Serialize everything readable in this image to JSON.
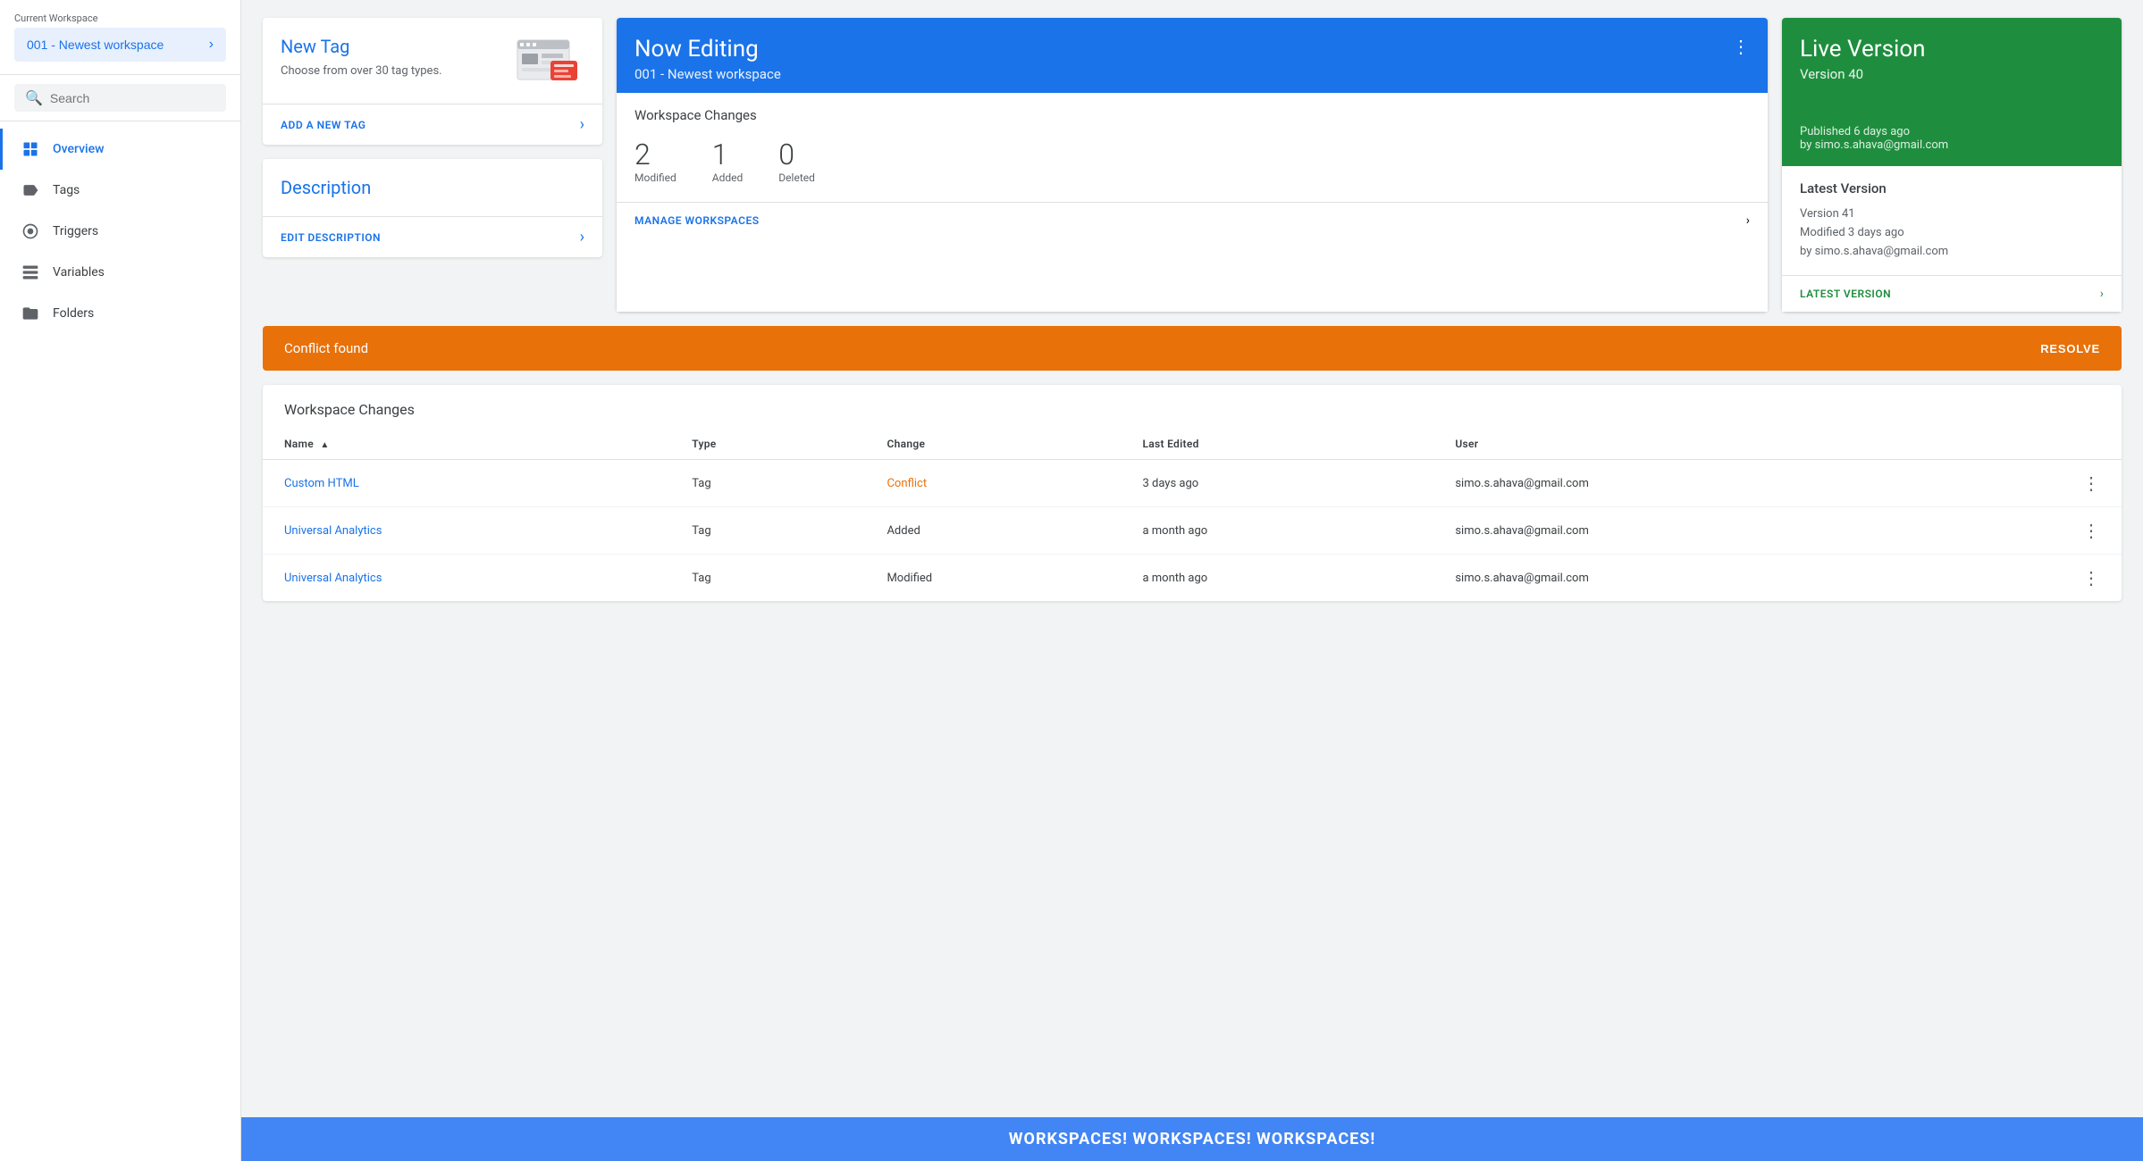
{
  "sidebar": {
    "current_label": "Current Workspace",
    "workspace_name": "001 - Newest workspace",
    "search_placeholder": "Search",
    "nav_items": [
      {
        "id": "overview",
        "label": "Overview",
        "icon": "folder-icon",
        "active": true
      },
      {
        "id": "tags",
        "label": "Tags",
        "icon": "tag-icon",
        "active": false
      },
      {
        "id": "triggers",
        "label": "Triggers",
        "icon": "trigger-icon",
        "active": false
      },
      {
        "id": "variables",
        "label": "Variables",
        "icon": "variable-icon",
        "active": false
      },
      {
        "id": "folders",
        "label": "Folders",
        "icon": "folders-icon",
        "active": false
      }
    ]
  },
  "new_tag_card": {
    "title": "New Tag",
    "description": "Choose from over 30 tag types.",
    "footer_link": "ADD A NEW TAG"
  },
  "description_card": {
    "title": "Description",
    "footer_link": "EDIT DESCRIPTION"
  },
  "now_editing_card": {
    "title": "Now Editing",
    "workspace_name": "001 - Newest workspace",
    "changes_title": "Workspace Changes",
    "stats": [
      {
        "number": "2",
        "label": "Modified"
      },
      {
        "number": "1",
        "label": "Added"
      },
      {
        "number": "0",
        "label": "Deleted"
      }
    ],
    "footer_link": "MANAGE WORKSPACES"
  },
  "live_version_card": {
    "title": "Live Version",
    "version": "Version 40",
    "published_text": "Published 6 days ago",
    "published_by": "by simo.s.ahava@gmail.com",
    "latest_section_title": "Latest Version",
    "version_detail": "Version 41",
    "modified_text": "Modified 3 days ago",
    "modified_by": "by simo.s.ahava@gmail.com",
    "footer_link": "LATEST VERSION"
  },
  "conflict_banner": {
    "text": "Conflict found",
    "resolve_label": "RESOLVE"
  },
  "workspace_changes_table": {
    "title": "Workspace Changes",
    "columns": [
      "Name",
      "Type",
      "Change",
      "Last Edited",
      "User"
    ],
    "rows": [
      {
        "name": "Custom HTML",
        "type": "Tag",
        "change": "Conflict",
        "last_edited": "3 days ago",
        "user": "simo.s.ahava@gmail.com",
        "change_class": "conflict"
      },
      {
        "name": "Universal Analytics",
        "type": "Tag",
        "change": "Added",
        "last_edited": "a month ago",
        "user": "simo.s.ahava@gmail.com",
        "change_class": "normal"
      },
      {
        "name": "Universal Analytics",
        "type": "Tag",
        "change": "Modified",
        "last_edited": "a month ago",
        "user": "simo.s.ahava@gmail.com",
        "change_class": "normal"
      }
    ]
  },
  "bottom_banner": {
    "text": "WORKSPACES! WORKSPACES! WORKSPACES!"
  }
}
